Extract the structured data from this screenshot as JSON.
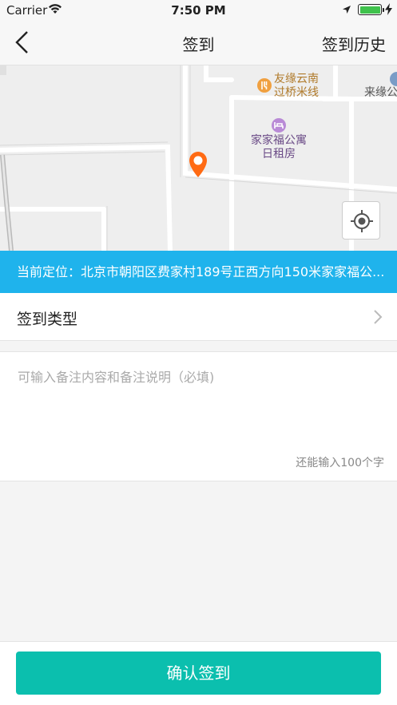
{
  "status_bar": {
    "carrier": "Carrier",
    "time": "7:50 PM"
  },
  "nav": {
    "title": "签到",
    "right_action": "签到历史"
  },
  "map": {
    "pois": [
      {
        "name": "友缘云南过桥米线",
        "icon": "restaurant-icon",
        "color": "#f0a040"
      },
      {
        "name": "家家福公寓日租房",
        "icon": "hotel-icon",
        "color": "#b98ad6"
      },
      {
        "name": "来缘公",
        "icon": "poi-icon",
        "color": "#7a9cc6"
      }
    ],
    "pin_color": "#ff6a13",
    "locate_icon": "crosshair-icon"
  },
  "location": {
    "text": "当前定位：北京市朝阳区费家村189号正西方向150米家家福公..."
  },
  "checkin_type": {
    "label": "签到类型"
  },
  "remark": {
    "placeholder": "可输入备注内容和备注说明（必填)",
    "counter": "还能输入100个字"
  },
  "confirm_button": {
    "label": "确认签到",
    "color": "#0bbfae"
  }
}
